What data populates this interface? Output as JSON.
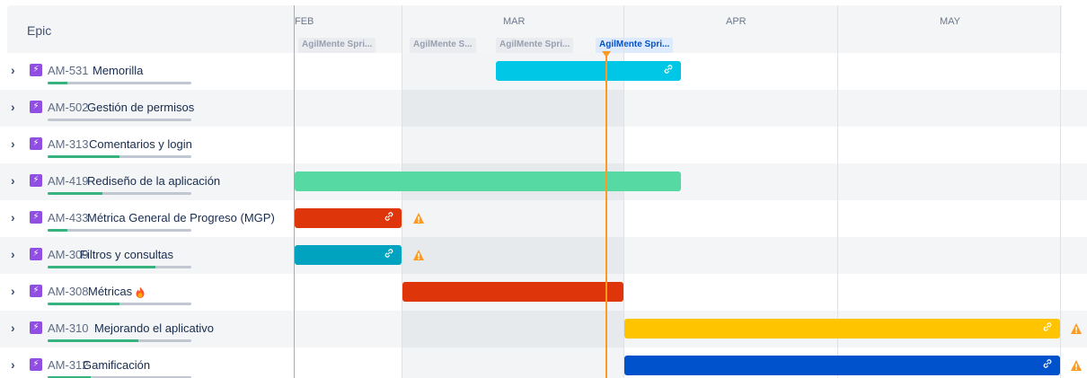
{
  "header": {
    "epic_column_title": "Epic"
  },
  "timeline": {
    "months": [
      "FEB",
      "MAR",
      "APR",
      "MAY"
    ],
    "sprints": [
      {
        "label": "AgilMente Spri...",
        "active": false
      },
      {
        "label": "AgilMente S...",
        "active": false
      },
      {
        "label": "AgilMente Spri...",
        "active": false
      },
      {
        "label": "AgilMente Spri...",
        "active": true
      }
    ]
  },
  "epics": [
    {
      "key": "AM-531",
      "name": "Memorilla",
      "progress_pct": 14,
      "bar_color": "#00c7e6",
      "has_link": true,
      "warning": false,
      "flame": false
    },
    {
      "key": "AM-502",
      "name": "Gestión de permisos",
      "progress_pct": 0,
      "bar_color": "",
      "has_link": false,
      "warning": false,
      "flame": false
    },
    {
      "key": "AM-313",
      "name": "Comentarios y login",
      "progress_pct": 50,
      "bar_color": "",
      "has_link": false,
      "warning": false,
      "flame": false
    },
    {
      "key": "AM-419",
      "name": "Rediseño de la aplicación",
      "progress_pct": 38,
      "bar_color": "#57d9a3",
      "has_link": false,
      "warning": false,
      "flame": false
    },
    {
      "key": "AM-433",
      "name": "Métrica General de Progreso (MGP)",
      "progress_pct": 14,
      "bar_color": "#de350b",
      "has_link": true,
      "warning": true,
      "flame": false
    },
    {
      "key": "AM-309",
      "name": "Filtros y consultas",
      "progress_pct": 75,
      "bar_color": "#00a3bf",
      "has_link": true,
      "warning": true,
      "flame": false
    },
    {
      "key": "AM-308",
      "name": "Métricas",
      "progress_pct": 50,
      "bar_color": "#de350b",
      "has_link": false,
      "warning": false,
      "flame": true
    },
    {
      "key": "AM-310",
      "name": "Mejorando el aplicativo",
      "progress_pct": 63,
      "bar_color": "#ffc400",
      "has_link": true,
      "warning": true,
      "flame": false
    },
    {
      "key": "AM-312",
      "name": "Gamificación",
      "progress_pct": 30,
      "bar_color": "#0052cc",
      "has_link": true,
      "warning": true,
      "flame": false
    }
  ],
  "icons": {
    "chevron": "chevron-right-icon",
    "epic": "epic-lightning-icon",
    "link": "link-icon",
    "warning": "warning-icon",
    "flame": "fire-emoji-icon"
  },
  "colors": {
    "today_marker": "#ff991f",
    "progress": "#36b37e",
    "epic_icon": "#904ee2",
    "warning": "#ff991f"
  }
}
